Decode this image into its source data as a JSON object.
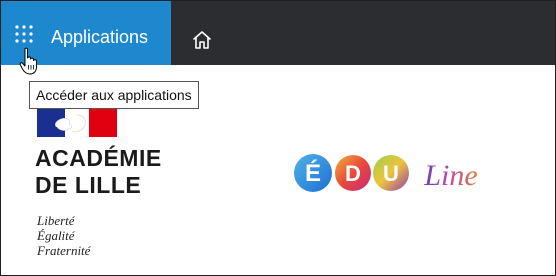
{
  "topbar": {
    "apps_label": "Applications",
    "apps_icon": "grid-dots-icon",
    "home_icon": "home-icon",
    "colors": {
      "bar": "#2b2d31",
      "apps_bg": "#1e88cf",
      "apps_text": "#ffffff"
    }
  },
  "tooltip": {
    "text": "Accéder aux applications"
  },
  "academie_logo": {
    "line1": "ACADÉMIE",
    "line2": "DE LILLE",
    "motto": [
      "Liberté",
      "Égalité",
      "Fraternité"
    ]
  },
  "eduline_logo": {
    "letters": [
      "É",
      "D",
      "U"
    ],
    "script_text": "Line"
  }
}
